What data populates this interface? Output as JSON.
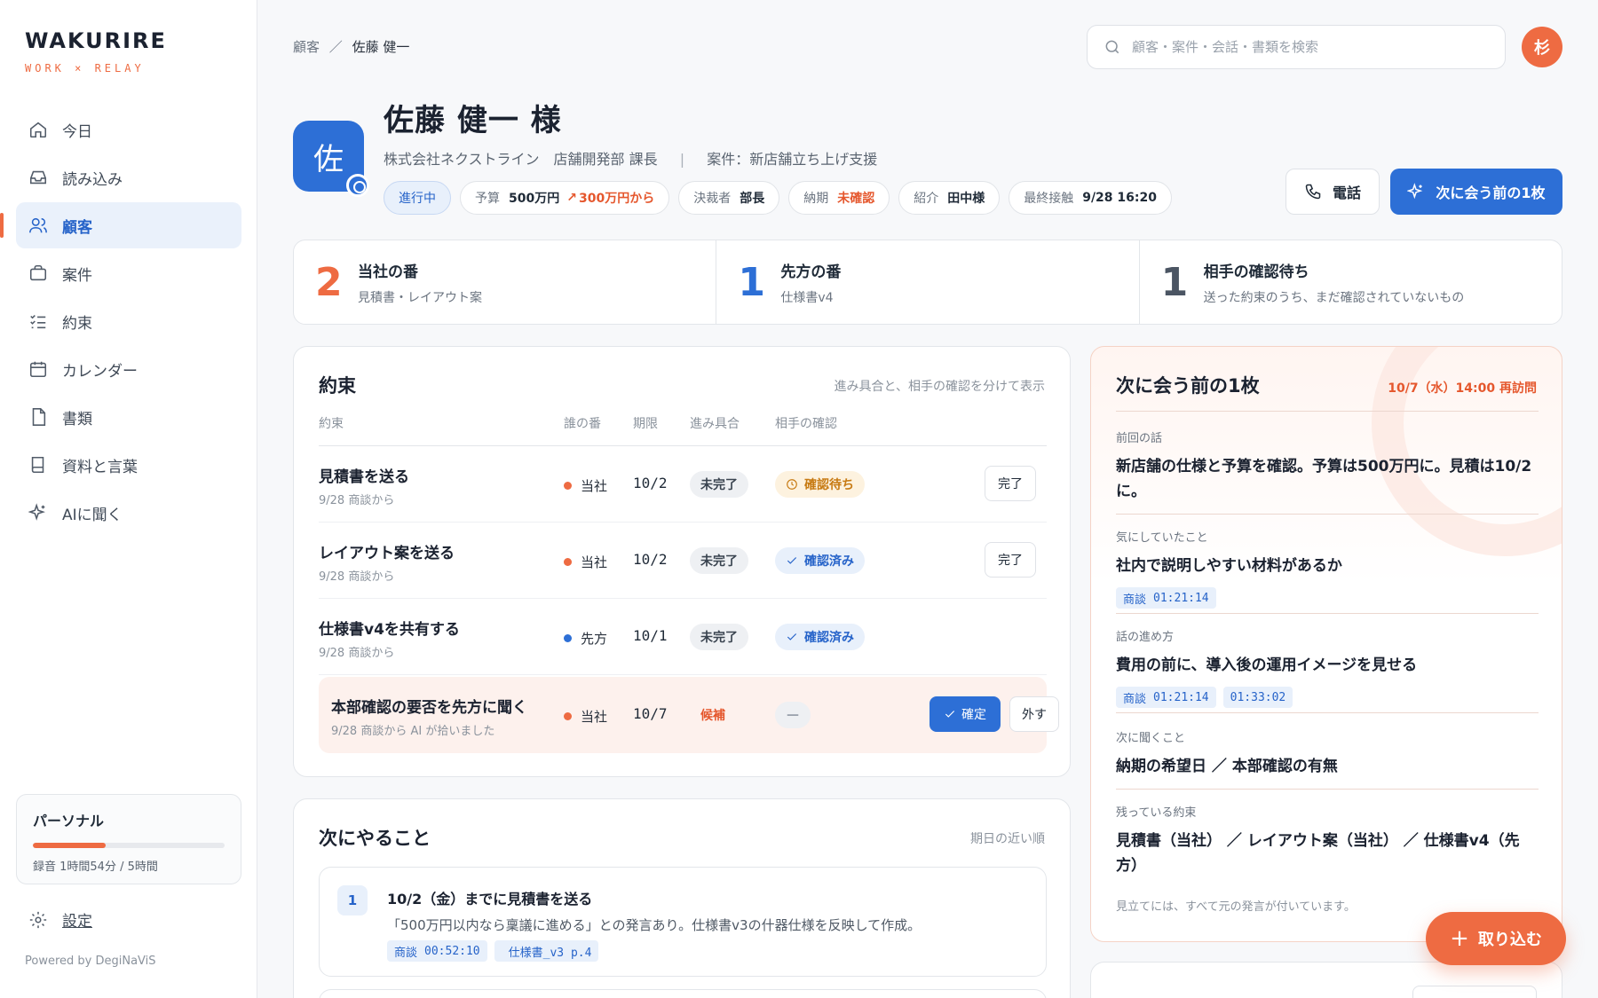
{
  "brand": {
    "name": "WAKURIRE",
    "tagline": "WORK × RELAY",
    "powered": "Powered by DegiNaViS"
  },
  "nav": [
    {
      "label": "今日",
      "icon": "home-icon"
    },
    {
      "label": "読み込み",
      "icon": "inbox-icon"
    },
    {
      "label": "顧客",
      "icon": "users-icon",
      "active": true
    },
    {
      "label": "案件",
      "icon": "briefcase-icon"
    },
    {
      "label": "約束",
      "icon": "checklist-icon"
    },
    {
      "label": "カレンダー",
      "icon": "calendar-icon"
    },
    {
      "label": "書類",
      "icon": "document-icon"
    },
    {
      "label": "資料と言葉",
      "icon": "book-icon"
    },
    {
      "label": "AIに聞く",
      "icon": "sparkle-icon"
    }
  ],
  "plan": {
    "title": "パーソナル",
    "usage": "録音 1時間54分 / 5時間",
    "used_fraction": 0.38
  },
  "settings_label": "設定",
  "breadcrumb": {
    "parent": "顧客",
    "separator": "／",
    "current": "佐藤 健一"
  },
  "search": {
    "placeholder": "顧客・案件・会話・書類を検索"
  },
  "user": {
    "initial": "杉"
  },
  "customer": {
    "initial": "佐",
    "name": "佐藤 健一 様",
    "company": "株式会社ネクストライン　店舗開発部 課長",
    "separator": "|",
    "project": "案件：新店舗立ち上げ支援",
    "status": "進行中",
    "chips": {
      "budget_label": "予算",
      "budget_value": "500万円",
      "budget_change": "300万円から",
      "decider_label": "決裁者",
      "decider_value": "部長",
      "due_label": "納期",
      "due_value": "未確認",
      "referral_label": "紹介",
      "referral_value": "田中様",
      "last_label": "最終接触",
      "last_value": "9/28 16:20"
    }
  },
  "actions": {
    "call": "電話",
    "next_brief": "次に会う前の1枚"
  },
  "summary": [
    {
      "count": "2",
      "title": "当社の番",
      "sub": "見積書・レイアウト案",
      "color": "#ee6b42"
    },
    {
      "count": "1",
      "title": "先方の番",
      "sub": "仕様書v4",
      "color": "#2d6fd6"
    },
    {
      "count": "1",
      "title": "相手の確認待ち",
      "sub": "送った約束のうち、まだ確認されていないもの",
      "color": "#4b5563"
    }
  ],
  "promises": {
    "title": "約束",
    "note": "進み具合と、相手の確認を分けて表示",
    "columns": {
      "item": "約束",
      "who": "誰の番",
      "due": "期限",
      "progress": "進み具合",
      "confirm": "相手の確認"
    },
    "rows": [
      {
        "title": "見積書を送る",
        "source": "9/28 商談から",
        "who": "当社",
        "who_color": "#ee6b42",
        "due": "10/2",
        "progress": "未完了",
        "confirm": "確認待ち",
        "action": "完了"
      },
      {
        "title": "レイアウト案を送る",
        "source": "9/28 商談から",
        "who": "当社",
        "who_color": "#ee6b42",
        "due": "10/2",
        "progress": "未完了",
        "confirm": "確認済み",
        "action": "完了"
      },
      {
        "title": "仕様書v4を共有する",
        "source": "9/28 商談から",
        "who": "先方",
        "who_color": "#2d6fd6",
        "due": "10/1",
        "progress": "未完了",
        "confirm": "確認済み"
      },
      {
        "title": "本部確認の要否を先方に聞く",
        "source": "9/28 商談から AI が拾いました",
        "who": "当社",
        "who_color": "#ee6b42",
        "due": "10/7",
        "progress": "候補",
        "confirm": "—",
        "confirm_btn": "確定",
        "remove_btn": "外す"
      }
    ]
  },
  "todo": {
    "title": "次にやること",
    "note": "期日の近い順",
    "items": [
      {
        "num": "1",
        "title": "10/2（金）までに見積書を送る",
        "desc": "「500万円以内なら稟議に進める」との発言あり。仕様書v3の什器仕様を反映して作成。",
        "tag1_label": "商談",
        "tag1_time": "00:52:10",
        "tag2": "仕様書_v3 p.4"
      }
    ]
  },
  "brief": {
    "title": "次に会う前の1枚",
    "date": "10/7（水）14:00 再訪問",
    "sections": [
      {
        "label": "前回の話",
        "text": "新店舗の仕様と予算を確認。予算は500万円に。見積は10/2に。"
      },
      {
        "label": "気にしていたこと",
        "text": "社内で説明しやすい材料があるか",
        "tag_label": "商談",
        "tags": [
          "01:21:14"
        ]
      },
      {
        "label": "話の進め方",
        "text": "費用の前に、導入後の運用イメージを見せる",
        "tag_label": "商談",
        "tags": [
          "01:21:14",
          "01:33:02"
        ]
      },
      {
        "label": "次に聞くこと",
        "text": "納期の希望日 ／ 本部確認の有無"
      },
      {
        "label": "残っている約束",
        "text": "見積書（当社） ／ レイアウト案（当社） ／ 仕様書v4（先方）"
      }
    ],
    "footer": "見立てには、すべて元の発言が付いています。"
  },
  "fab": {
    "label": "取り込む"
  }
}
